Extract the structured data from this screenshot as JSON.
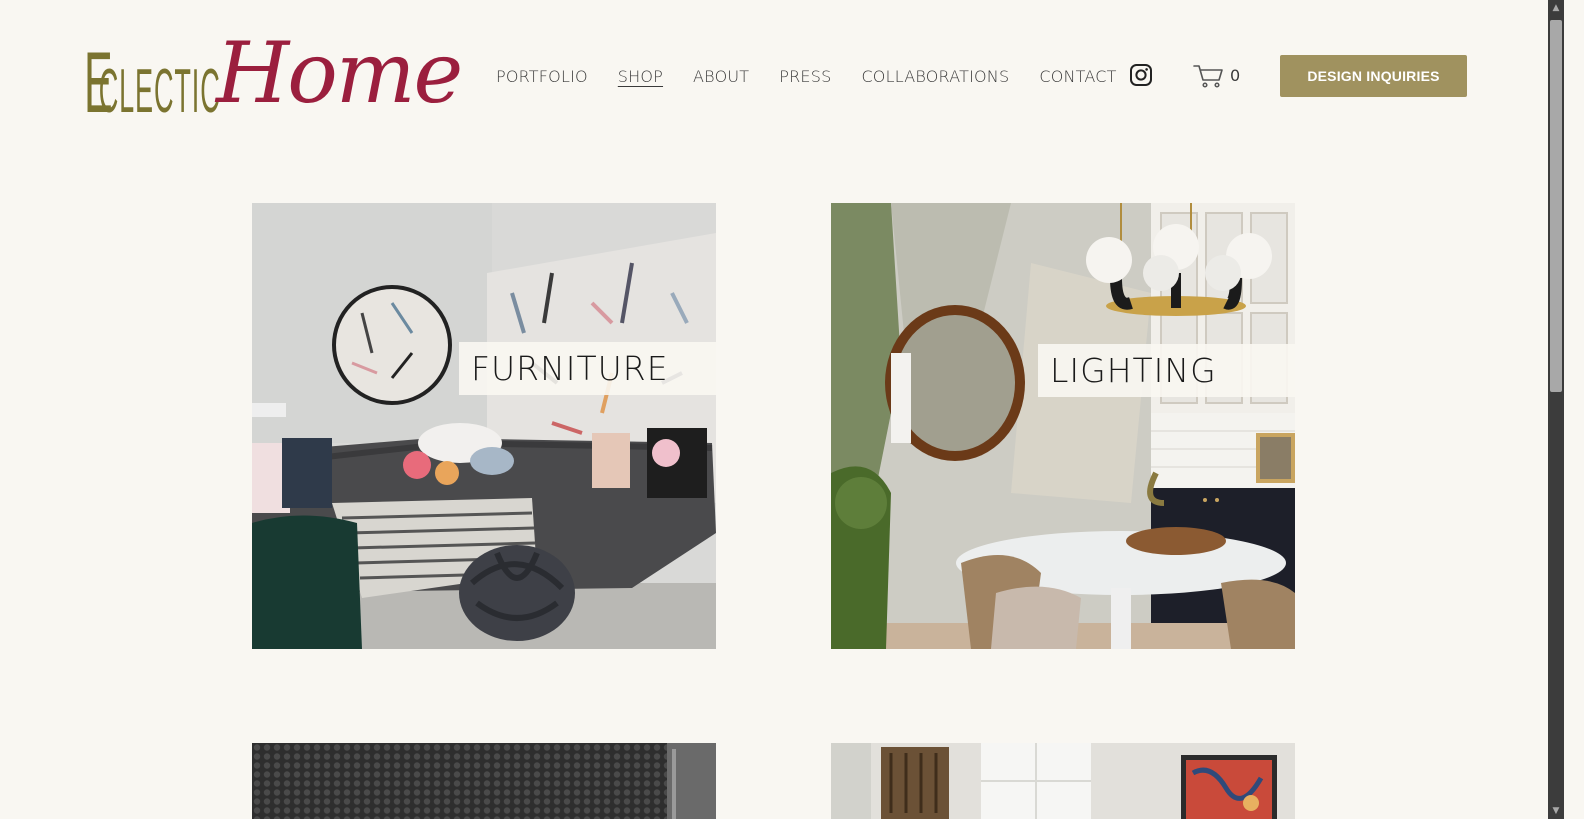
{
  "brand": {
    "word1": "Eclectic",
    "word2": "Home"
  },
  "nav": {
    "items": [
      {
        "label": "PORTFOLIO"
      },
      {
        "label": "SHOP"
      },
      {
        "label": "ABOUT"
      },
      {
        "label": "PRESS"
      },
      {
        "label": "COLLABORATIONS"
      },
      {
        "label": "CONTACT"
      }
    ],
    "active": "SHOP",
    "cart_count": "0",
    "cta_label": "DESIGN INQUIRIES"
  },
  "icons": {
    "instagram": "instagram-icon",
    "cart": "cart-icon"
  },
  "colors": {
    "background": "#f9f7f2",
    "logo_olive": "#7b7430",
    "logo_crimson": "#9b1f3e",
    "cta": "#a0925f"
  },
  "tiles": [
    {
      "label": "FURNITURE"
    },
    {
      "label": "LIGHTING"
    }
  ]
}
